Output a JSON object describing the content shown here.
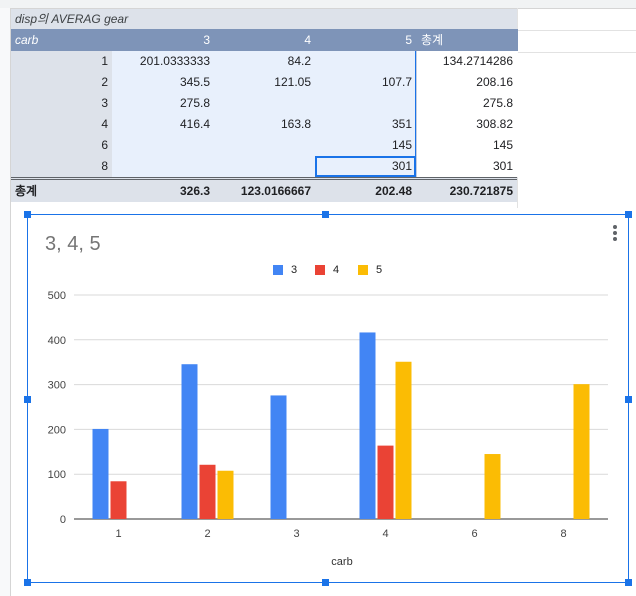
{
  "pivot": {
    "title": "disp의 AVERAG gear",
    "row_header": "carb",
    "columns": [
      "3",
      "4",
      "5"
    ],
    "total_label": "총계",
    "rows": [
      {
        "carb": "1",
        "values": [
          "201.0333333",
          "84.2",
          ""
        ],
        "total": "134.2714286"
      },
      {
        "carb": "2",
        "values": [
          "345.5",
          "121.05",
          "107.7"
        ],
        "total": "208.16"
      },
      {
        "carb": "3",
        "values": [
          "275.8",
          "",
          ""
        ],
        "total": "275.8"
      },
      {
        "carb": "4",
        "values": [
          "416.4",
          "163.8",
          "351"
        ],
        "total": "308.82"
      },
      {
        "carb": "6",
        "values": [
          "",
          "",
          "145"
        ],
        "total": "145"
      },
      {
        "carb": "8",
        "values": [
          "",
          "",
          "301"
        ],
        "total": "301"
      }
    ],
    "footer": {
      "label": "총계",
      "values": [
        "326.3",
        "123.0166667",
        "202.48"
      ],
      "total": "230.721875"
    }
  },
  "chart_data": {
    "type": "bar",
    "title": "3, 4, 5",
    "xlabel": "carb",
    "ylabel": "",
    "categories": [
      "1",
      "2",
      "3",
      "4",
      "6",
      "8"
    ],
    "series": [
      {
        "name": "3",
        "color": "#4285f4",
        "values": [
          201.0333333,
          345.5,
          275.8,
          416.4,
          null,
          null
        ]
      },
      {
        "name": "4",
        "color": "#ea4335",
        "values": [
          84.2,
          121.05,
          null,
          163.8,
          null,
          null
        ]
      },
      {
        "name": "5",
        "color": "#fbbc04",
        "values": [
          null,
          107.7,
          null,
          351,
          145,
          301
        ]
      }
    ],
    "ylim": [
      0,
      500
    ],
    "yticks": [
      "0",
      "100",
      "200",
      "300",
      "400",
      "500"
    ],
    "grid": true,
    "legend_position": "top"
  }
}
